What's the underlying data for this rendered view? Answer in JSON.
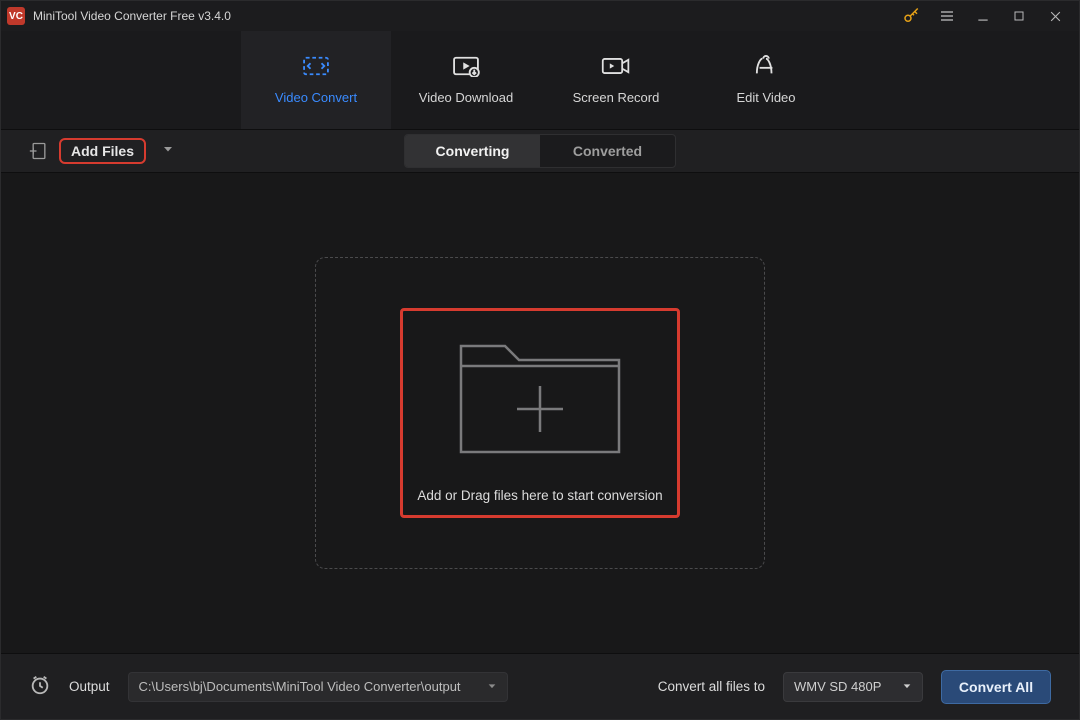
{
  "title": "MiniTool Video Converter Free v3.4.0",
  "tabs": {
    "convert": "Video Convert",
    "download": "Video Download",
    "record": "Screen Record",
    "edit": "Edit Video"
  },
  "toolbar": {
    "add_files": "Add Files",
    "seg_converting": "Converting",
    "seg_converted": "Converted"
  },
  "dropzone": {
    "hint": "Add or Drag files here to start conversion"
  },
  "bottom": {
    "output_label": "Output",
    "output_path": "C:\\Users\\bj\\Documents\\MiniTool Video Converter\\output",
    "convert_all_to_label": "Convert all files to",
    "format": "WMV SD 480P",
    "convert_all": "Convert All"
  },
  "colors": {
    "accent_blue": "#3a8bff",
    "highlight_red": "#d63b2f",
    "key_gold": "#e6a117"
  }
}
